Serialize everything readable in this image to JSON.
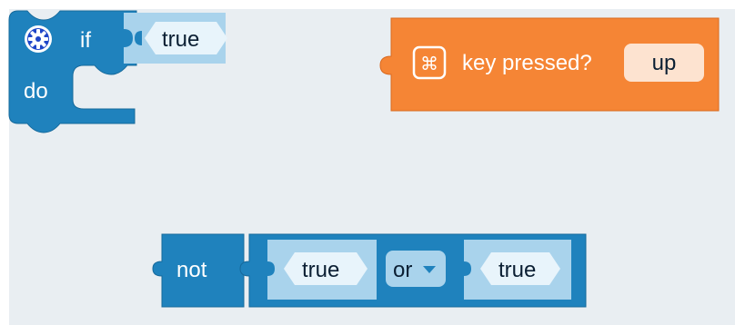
{
  "colors": {
    "workspace": "#e9eef2",
    "logic_block": "#1f82bd",
    "logic_block_border": "#16699b",
    "logic_inner": "#a9d3ec",
    "input_block": "#f58535",
    "input_block_border": "#d9691f",
    "field_fill": "#fde3d0",
    "bool_fill": "#e8f4fb"
  },
  "if_block": {
    "icon": "gear-icon",
    "if_label": "if",
    "condition_value": "true",
    "do_label": "do"
  },
  "key_block": {
    "icon": "command-key-icon",
    "label": "key pressed?",
    "key_value": "up"
  },
  "not_block": {
    "not_label": "not",
    "left_value": "true",
    "operator": "or",
    "operator_icon": "dropdown-arrow-icon",
    "right_value": "true"
  }
}
